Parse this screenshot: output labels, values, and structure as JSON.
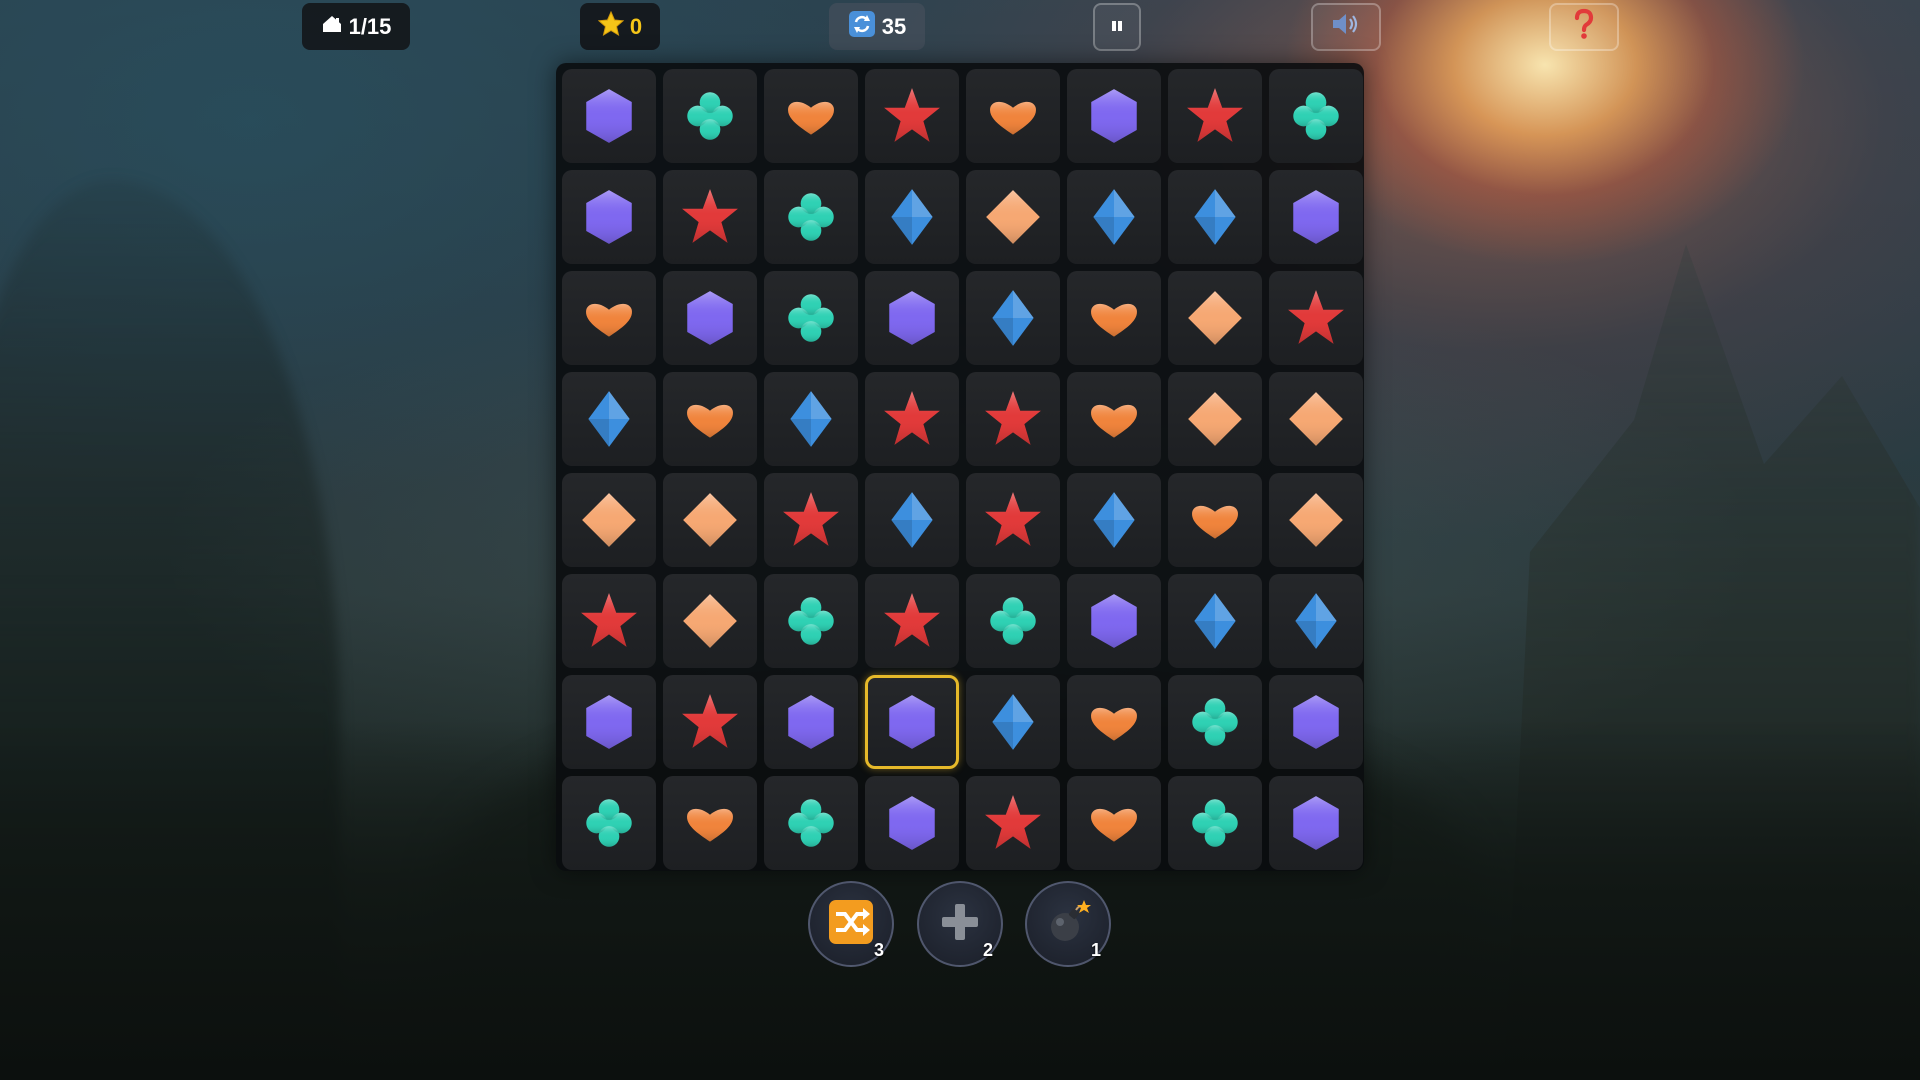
{
  "hud": {
    "level": {
      "icon": "house-icon",
      "text": "1/15"
    },
    "score": {
      "icon": "star-icon",
      "value": "0"
    },
    "moves": {
      "icon": "refresh-icon",
      "value": "35"
    },
    "pause": {
      "icon": "pause-icon"
    },
    "sound": {
      "icon": "speaker-icon"
    },
    "help": {
      "icon": "question-icon"
    }
  },
  "board": {
    "rows": 8,
    "cols": 8,
    "grid": [
      [
        "hexagon",
        "clover",
        "heart",
        "star",
        "heart",
        "hexagon",
        "star",
        "clover"
      ],
      [
        "hexagon",
        "star",
        "clover",
        "diamond",
        "topaz",
        "diamond",
        "diamond",
        "hexagon"
      ],
      [
        "heart",
        "hexagon",
        "clover",
        "hexagon",
        "diamond",
        "heart",
        "topaz",
        "star"
      ],
      [
        "diamond",
        "heart",
        "diamond",
        "star",
        "star",
        "heart",
        "topaz",
        "topaz"
      ],
      [
        "topaz",
        "topaz",
        "star",
        "diamond",
        "star",
        "diamond",
        "heart",
        "topaz"
      ],
      [
        "star",
        "topaz",
        "clover",
        "star",
        "clover",
        "hexagon",
        "diamond",
        "diamond"
      ],
      [
        "hexagon",
        "star",
        "hexagon",
        "hexagon",
        "diamond",
        "heart",
        "clover",
        "hexagon"
      ],
      [
        "clover",
        "heart",
        "clover",
        "hexagon",
        "star",
        "heart",
        "clover",
        "hexagon"
      ]
    ],
    "selected": {
      "row": 6,
      "col": 3
    }
  },
  "gem_colors": {
    "hexagon": "#7f68f0",
    "clover": "#2fd1b4",
    "heart": "#f0843c",
    "star": "#e23a3a",
    "diamond": "#3d8fde",
    "topaz": "#f6a873"
  },
  "powerups": [
    {
      "id": "shuffle",
      "icon": "shuffle-icon",
      "count": "3"
    },
    {
      "id": "add",
      "icon": "plus-icon",
      "count": "2"
    },
    {
      "id": "bomb",
      "icon": "bomb-icon",
      "count": "1"
    }
  ],
  "colors": {
    "selection": "#e6b92a",
    "score_text": "#f5c518"
  }
}
